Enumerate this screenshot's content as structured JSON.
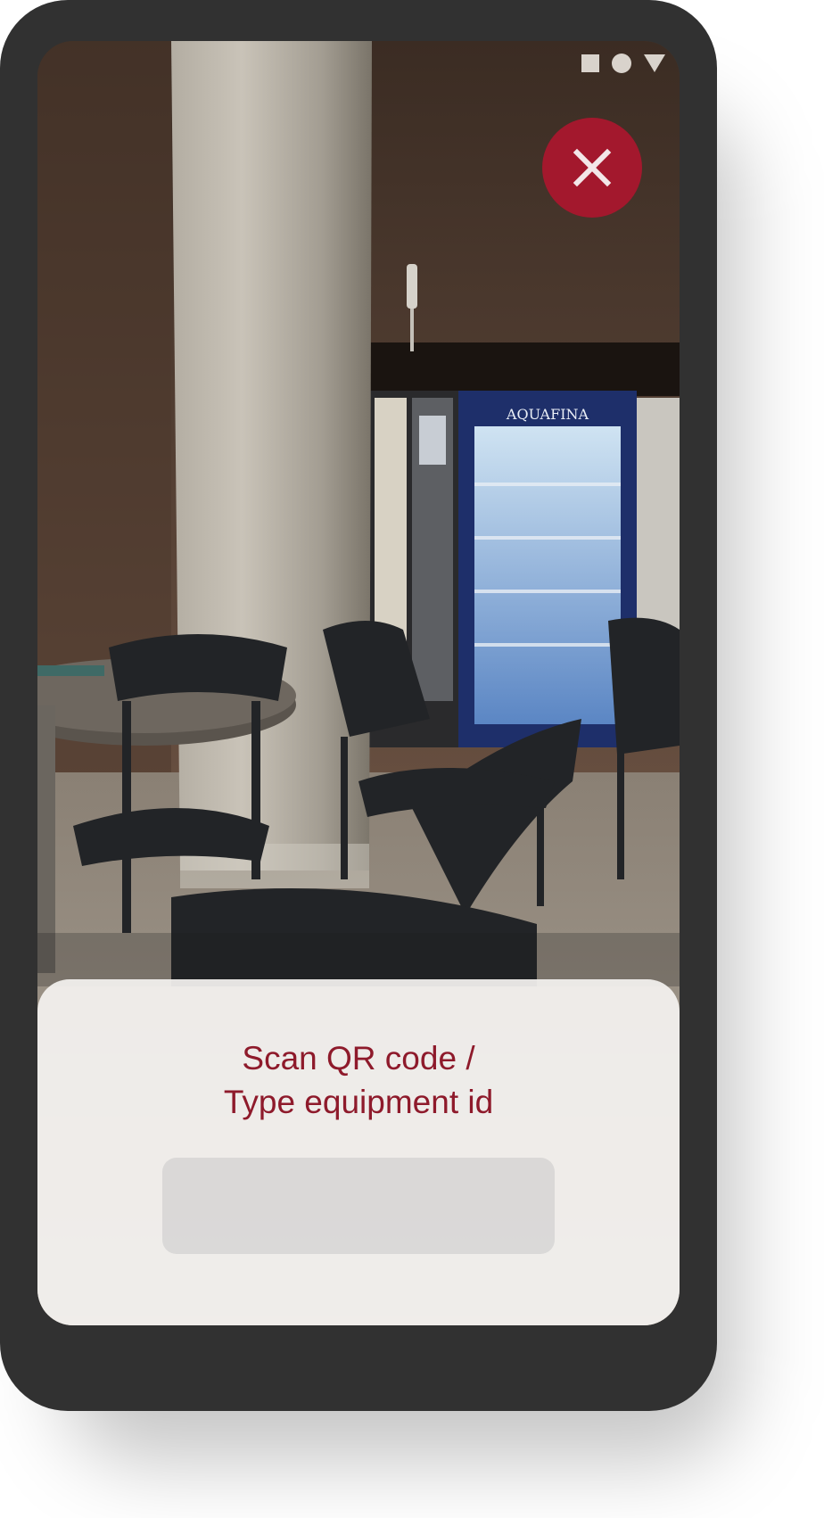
{
  "status_bar": {
    "icons": [
      "square-icon",
      "circle-icon",
      "triangle-icon"
    ],
    "color": "#d9d3cc"
  },
  "close_button": {
    "icon": "close-icon",
    "color": "#a3182d"
  },
  "scan_sheet": {
    "title_line1": "Scan QR code /",
    "title_line2": "Type equipment id",
    "title_color": "#8e1a2b",
    "input_value": "",
    "input_placeholder": ""
  },
  "camera_preview": {
    "vending_machine_brand": "AQUAFINA"
  }
}
